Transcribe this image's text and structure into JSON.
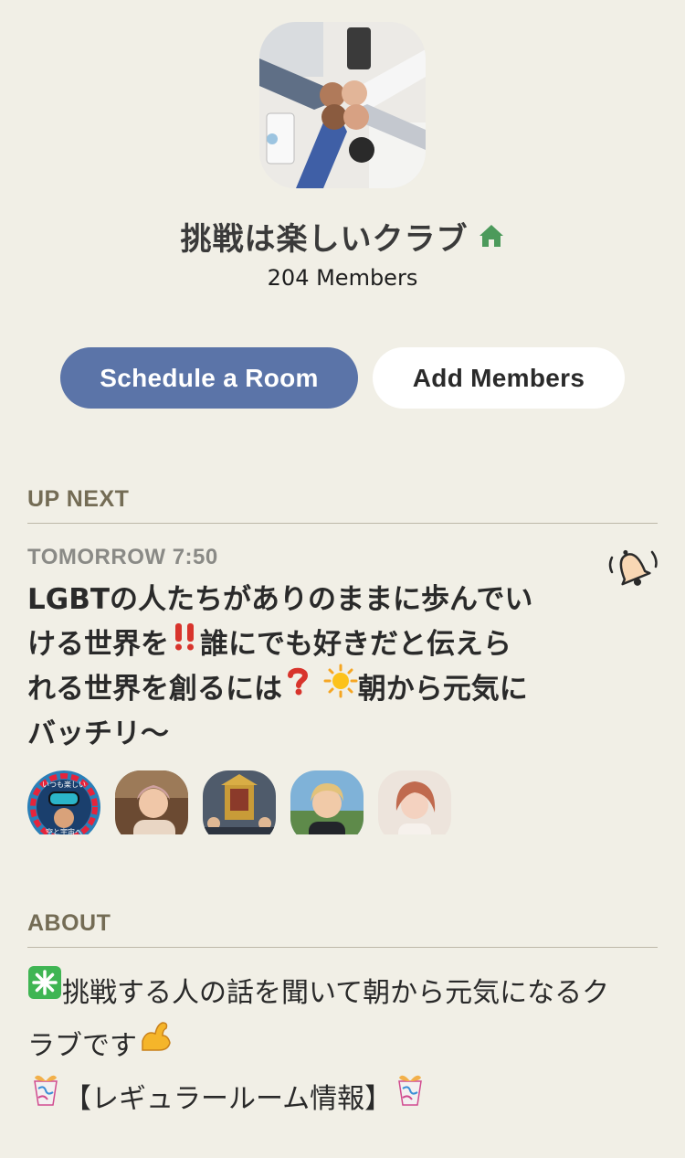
{
  "club": {
    "name": "挑戦は楽しいクラブ",
    "member_count": "204 Members",
    "home_icon": "house-icon",
    "image": "fist-bump-photo"
  },
  "actions": {
    "schedule_label": "Schedule a Room",
    "add_members_label": "Add Members"
  },
  "up_next": {
    "section_label": "UP NEXT",
    "event": {
      "time": "TOMORROW 7:50",
      "title_line1": "LGBTの人たちがありのままに歩んでい",
      "title_line2a": "ける世界を",
      "title_line2b": "誰にでも好きだと伝えら",
      "title_line3a": "れる世界を創るには",
      "title_line3b": "朝から元気に",
      "title_line4": "バッチリ〜",
      "emoji": [
        "double-exclamation-icon",
        "question-mark-icon",
        "sun-icon"
      ],
      "bell_icon": "bell-ringing-icon",
      "speakers": [
        "speaker-1",
        "speaker-2",
        "speaker-3",
        "speaker-4",
        "speaker-5"
      ],
      "speaker1_badge_top": "いつも楽しい",
      "speaker1_badge_bottom": "空と宇宙へ"
    }
  },
  "about": {
    "section_label": "ABOUT",
    "line1": "挑戦する人の話を聞いて朝から元気になるク",
    "line2": "ラブです",
    "line3": "【レギュラールーム情報】",
    "icons": [
      "sparkle-icon",
      "flexed-biceps-icon",
      "gift-icon"
    ]
  },
  "colors": {
    "background": "#f1efe6",
    "primary_button": "#5b74a8",
    "section_label": "#746c55",
    "home_green": "#4c9a5b",
    "bell_orange": "#f2a65a"
  }
}
